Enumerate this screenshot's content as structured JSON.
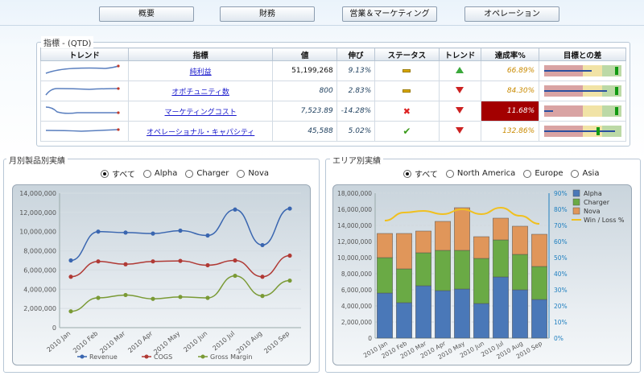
{
  "nav": {
    "tabs": [
      "概要",
      "財務",
      "営業＆マーケティング",
      "オペレーション"
    ]
  },
  "kpi": {
    "title": "指標 - (QTD)",
    "headers": [
      "トレンド",
      "指標",
      "値",
      "伸び",
      "ステータス",
      "トレンド",
      "達成率%",
      "目標との差"
    ],
    "rows": [
      {
        "name": "純利益",
        "value": "51,199,268",
        "growth": "9.13%",
        "status": "neutral",
        "trend": "up",
        "rate": "66.89%",
        "rate_bad": false
      },
      {
        "name": "オポチュニティ数",
        "value": "800",
        "growth": "2.83%",
        "status": "neutral",
        "trend": "down",
        "rate": "84.30%",
        "rate_bad": false
      },
      {
        "name": "マーケティングコスト",
        "value": "7,523.89",
        "growth": "-14.28%",
        "status": "bad",
        "trend": "down",
        "rate": "11.68%",
        "rate_bad": true
      },
      {
        "name": "オペレーショナル・キャパシティ",
        "value": "45,588",
        "growth": "5.02%",
        "status": "good",
        "trend": "down",
        "rate": "132.86%",
        "rate_bad": false
      }
    ],
    "bullet_fill": [
      0.62,
      0.82,
      0.12,
      0.92
    ],
    "bullet_target": [
      0.94,
      0.94,
      0.94,
      0.7
    ]
  },
  "left_panel": {
    "title": "月別製品別実績",
    "radio_options": [
      "すべて",
      "Alpha",
      "Charger",
      "Nova"
    ],
    "selected": "すべて"
  },
  "right_panel": {
    "title": "エリア別実績",
    "radio_options": [
      "すべて",
      "North America",
      "Europe",
      "Asia"
    ],
    "selected": "すべて"
  },
  "colors": {
    "revenue": "#3a66b0",
    "cogs": "#b03a35",
    "gross_margin": "#7a9a35",
    "alpha": "#4a78b8",
    "charger": "#6aaa45",
    "nova": "#e0965a",
    "winloss": "#f0c020"
  },
  "chart_data": [
    {
      "type": "line",
      "categories": [
        "2010 Jan",
        "2010 Feb",
        "2010 Mar",
        "2010 Apr",
        "2010 May",
        "2010 Jun",
        "2010 Jul",
        "2010 Aug",
        "2010 Sep"
      ],
      "series": [
        {
          "name": "Revenue",
          "values": [
            7000000,
            10000000,
            9900000,
            9800000,
            10100000,
            9600000,
            12300000,
            8600000,
            12400000
          ]
        },
        {
          "name": "COGS",
          "values": [
            5300000,
            6900000,
            6600000,
            6900000,
            6950000,
            6500000,
            7000000,
            5300000,
            7500000
          ]
        },
        {
          "name": "Gross Margin",
          "values": [
            1700000,
            3100000,
            3400000,
            3000000,
            3200000,
            3100000,
            5400000,
            3300000,
            4900000
          ]
        }
      ],
      "yticks": [
        "0",
        "2,000,000",
        "4,000,000",
        "6,000,000",
        "8,000,000",
        "10,000,000",
        "12,000,000",
        "14,000,000"
      ],
      "ylim": [
        0,
        14000000
      ],
      "legend": "bottom"
    },
    {
      "type": "bar",
      "stacked": true,
      "categories": [
        "2010 Jan",
        "2010 Feb",
        "2010 Mar",
        "2010 Apr",
        "2010 May",
        "2010 Jun",
        "2010 Jul",
        "2010 Aug",
        "2010 Sep"
      ],
      "series": [
        {
          "name": "Alpha",
          "values": [
            5600000,
            4400000,
            6500000,
            5900000,
            6100000,
            4300000,
            7600000,
            6000000,
            4800000
          ]
        },
        {
          "name": "Charger",
          "values": [
            4400000,
            4200000,
            4100000,
            5000000,
            4800000,
            5600000,
            4600000,
            4400000,
            4100000
          ]
        },
        {
          "name": "Nova",
          "values": [
            3000000,
            4400000,
            2700000,
            3600000,
            5300000,
            2700000,
            2700000,
            3500000,
            4000000
          ]
        },
        {
          "name": "Win / Loss %",
          "axis": "right",
          "values": [
            73,
            78,
            79,
            77,
            80,
            77,
            81,
            76,
            71
          ]
        }
      ],
      "yticks_left": [
        "0",
        "2,000,000",
        "4,000,000",
        "6,000,000",
        "8,000,000",
        "10,000,000",
        "12,000,000",
        "14,000,000",
        "16,000,000",
        "18,000,000"
      ],
      "yticks_right": [
        "0%",
        "10%",
        "20%",
        "30%",
        "40%",
        "50%",
        "60%",
        "70%",
        "80%",
        "90%"
      ],
      "ylim": [
        0,
        18000000
      ],
      "ylim_right": [
        0,
        90
      ],
      "legend": "right"
    }
  ]
}
